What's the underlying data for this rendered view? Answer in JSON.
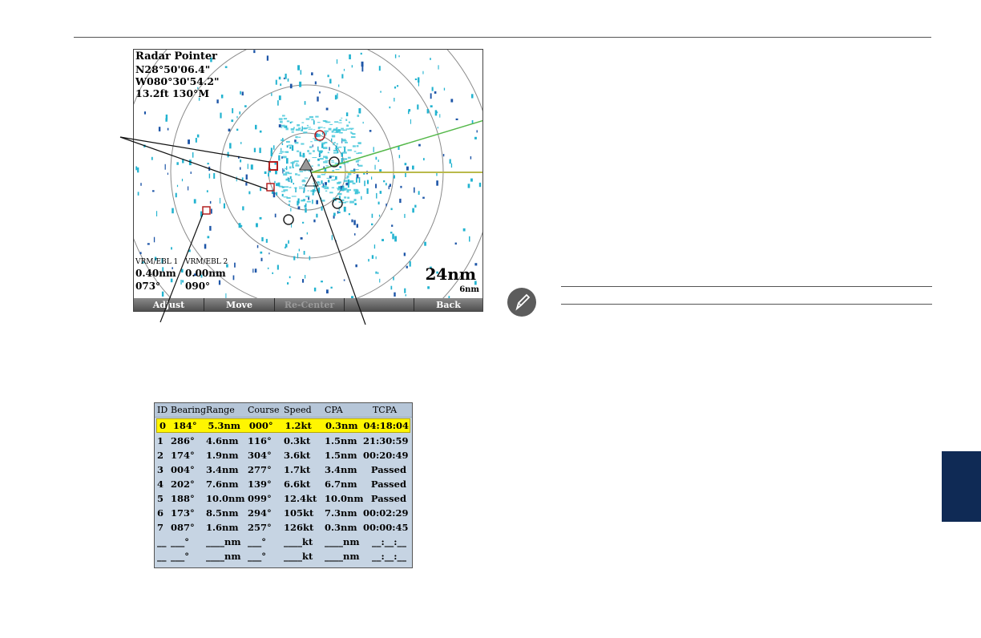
{
  "radar": {
    "pointer_title": "Radar Pointer",
    "latitude": "N28°50'06.4\"",
    "longitude": "W080°30'54.2\"",
    "depth_bearing": "13.2ft  130°M",
    "vrm1_label": "VRM/EBL 1",
    "vrm1_range": "0.40nm",
    "vrm1_bearing": "073°",
    "vrm2_label": "VRM/EBL 2",
    "vrm2_range": "0.00nm",
    "vrm2_bearing": "090°",
    "range_value": "24nm",
    "ring_value": "6nm",
    "softkeys": [
      "Adjust",
      "Move",
      "Re-Center",
      "",
      "Back"
    ],
    "colors": {
      "target_red": "#b32020",
      "echo_cyan": "#22b3d0",
      "heading_line": "#b9b94a",
      "cog_line": "#55b84a"
    }
  },
  "target_table": {
    "headers": [
      "ID",
      "Bearing",
      "Range",
      "Course",
      "Speed",
      "CPA",
      "TCPA"
    ],
    "rows": [
      [
        "0",
        "184°",
        "5.3nm",
        "000°",
        "1.2kt",
        "0.3nm",
        "04:18:04"
      ],
      [
        "1",
        "286°",
        "4.6nm",
        "116°",
        "0.3kt",
        "1.5nm",
        "21:30:59"
      ],
      [
        "2",
        "174°",
        "1.9nm",
        "304°",
        "3.6kt",
        "1.5nm",
        "00:20:49"
      ],
      [
        "3",
        "004°",
        "3.4nm",
        "277°",
        "1.7kt",
        "3.4nm",
        "Passed"
      ],
      [
        "4",
        "202°",
        "7.6nm",
        "139°",
        "6.6kt",
        "6.7nm",
        "Passed"
      ],
      [
        "5",
        "188°",
        "10.0nm",
        "099°",
        "12.4kt",
        "10.0nm",
        "Passed"
      ],
      [
        "6",
        "173°",
        "8.5nm",
        "294°",
        "105kt",
        "7.3nm",
        "00:02:29"
      ],
      [
        "7",
        "087°",
        "1.6nm",
        "257°",
        "126kt",
        "0.3nm",
        "00:00:45"
      ],
      [
        "__",
        "___°",
        "____nm",
        "___°",
        "____kt",
        "____nm",
        "__:__:__"
      ],
      [
        "__",
        "___°",
        "____nm",
        "___°",
        "____kt",
        "____nm",
        "__:__:__"
      ]
    ],
    "selected_row": 0
  }
}
